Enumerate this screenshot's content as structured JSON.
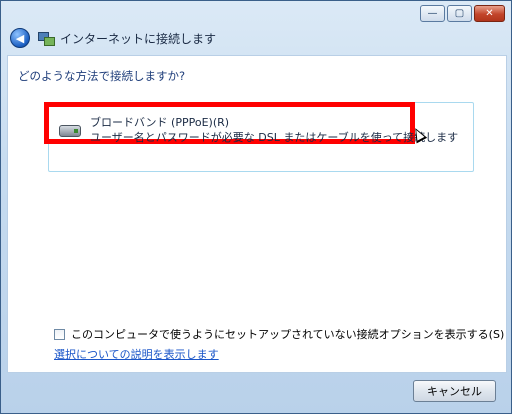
{
  "window": {
    "title": "インターネットに接続します",
    "controls": {
      "minimize": "—",
      "maximize": "▢",
      "close": "✕"
    }
  },
  "content": {
    "question": "どのような方法で接続しますか?",
    "option": {
      "title": "ブロードバンド (PPPoE)(R)",
      "description": "ユーザー名とパスワードが必要な DSL またはケーブルを使って接続します",
      "icon": "modem-icon"
    },
    "checkbox": {
      "label": "このコンピュータで使うようにセットアップされていない接続オプションを表示する(S)",
      "checked": false
    },
    "help_link": "選択についての説明を表示します"
  },
  "footer": {
    "cancel_label": "キャンセル"
  },
  "colors": {
    "highlight": "#ff0000",
    "link": "#1a55c8",
    "heading": "#1e3d7a"
  }
}
